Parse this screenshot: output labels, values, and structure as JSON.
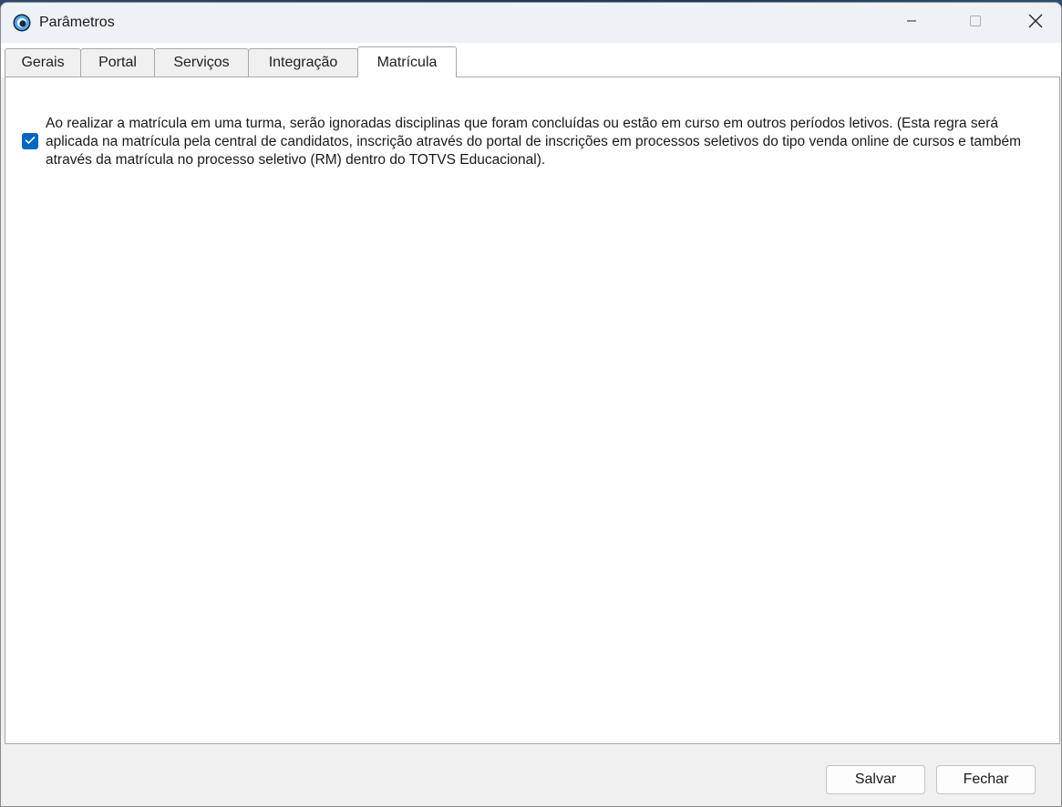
{
  "window": {
    "title": "Parâmetros",
    "icon": "app-logo-icon"
  },
  "title_controls": {
    "minimize_icon": "minimize-icon",
    "maximize_icon": "maximize-icon",
    "close_icon": "close-icon"
  },
  "tabs": [
    {
      "label": "Gerais",
      "active": false
    },
    {
      "label": "Portal",
      "active": false
    },
    {
      "label": "Serviços",
      "active": false
    },
    {
      "label": "Integração",
      "active": false
    },
    {
      "label": "Matrícula",
      "active": true
    }
  ],
  "matricula": {
    "option": {
      "checked": true,
      "label": "Ao realizar a matrícula em uma turma, serão ignoradas disciplinas que foram concluídas ou estão em curso em outros períodos letivos. (Esta regra será aplicada na matrícula pela central de candidatos, inscrição através do portal de inscrições em processos seletivos do tipo venda online de cursos e também através da matrícula no processo seletivo (RM) dentro do TOTVS Educacional)."
    }
  },
  "footer": {
    "save_label": "Salvar",
    "close_label": "Fechar"
  },
  "colors": {
    "accent": "#0067c0",
    "titlebar": "#eef1f6",
    "window_bg": "#f0f0f0",
    "panel_bg": "#ffffff",
    "border": "#a9a9a9"
  }
}
